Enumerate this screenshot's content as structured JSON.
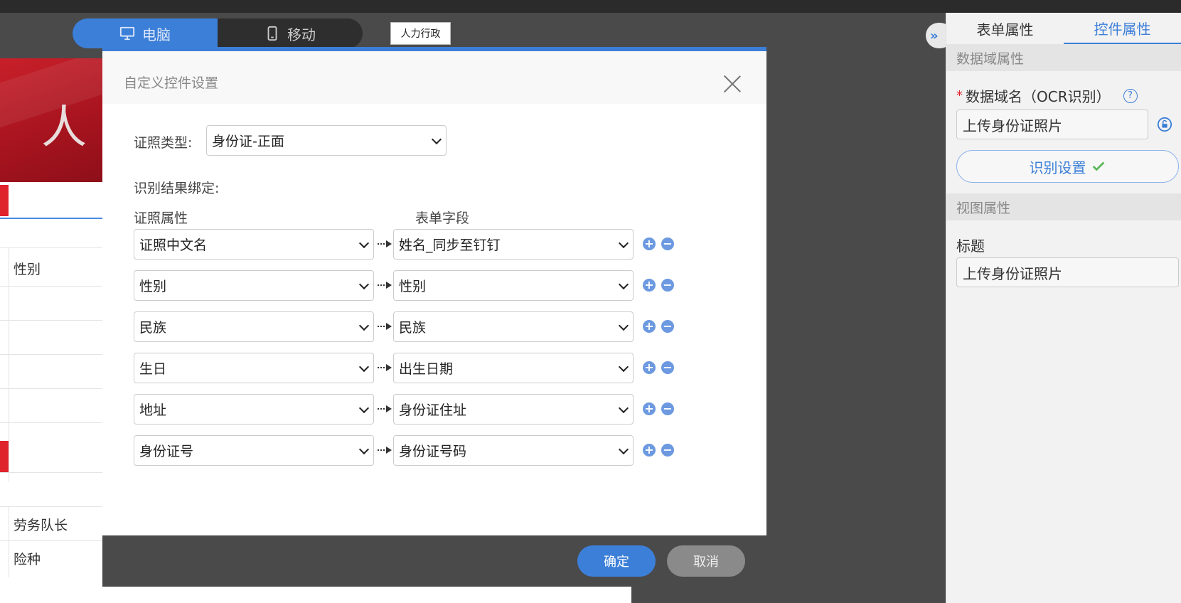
{
  "device_switch": {
    "desktop_label": "电脑",
    "mobile_label": "移动"
  },
  "dept_tag": "人力行政",
  "canvas": {
    "banner_char": "人",
    "labels": [
      "性别",
      "劳务队长",
      "险种"
    ]
  },
  "modal": {
    "title": "自定义控件设置",
    "doc_type_label": "证照类型:",
    "doc_type_value": "身份证-正面",
    "binding_label": "识别结果绑定:",
    "col_attr": "证照属性",
    "col_field": "表单字段",
    "rows": [
      {
        "attr": "证照中文名",
        "field": "姓名_同步至钉钉"
      },
      {
        "attr": "性别",
        "field": "性别"
      },
      {
        "attr": "民族",
        "field": "民族"
      },
      {
        "attr": "生日",
        "field": "出生日期"
      },
      {
        "attr": "地址",
        "field": "身份证住址"
      },
      {
        "attr": "身份证号",
        "field": "身份证号码"
      }
    ],
    "ok_label": "确定",
    "cancel_label": "取消"
  },
  "right_panel": {
    "tab_form": "表单属性",
    "tab_control": "控件属性",
    "section_data": "数据域属性",
    "data_field_label": "数据域名（OCR识别）",
    "data_field_value": "上传身份证照片",
    "ocr_button": "识别设置",
    "section_view": "视图属性",
    "title_label": "标题",
    "title_value": "上传身份证照片"
  },
  "colors": {
    "accent": "#3c7fd8",
    "danger": "#e0242c",
    "success": "#5cb85c"
  }
}
